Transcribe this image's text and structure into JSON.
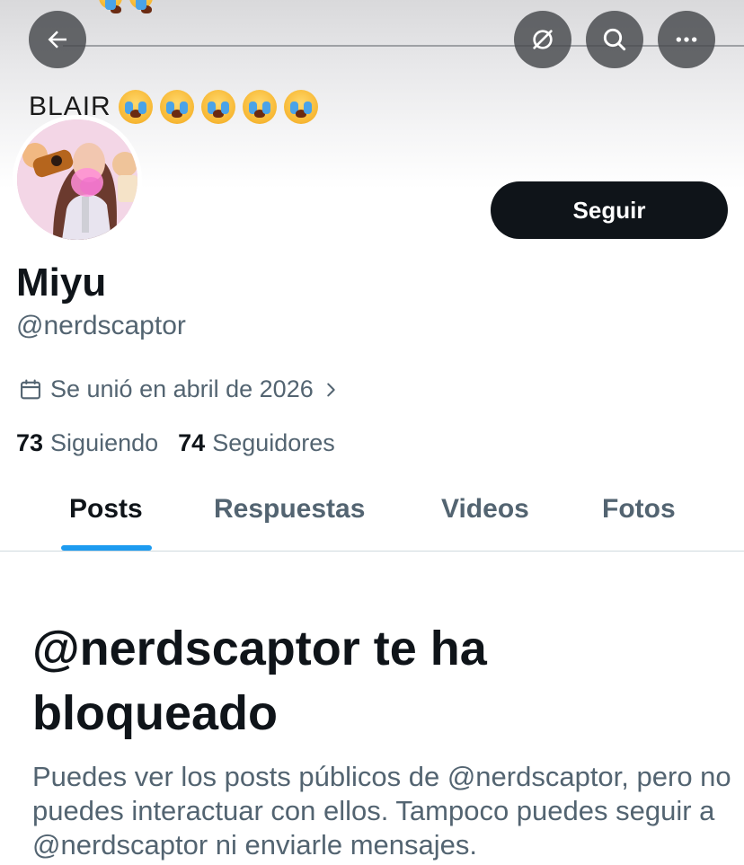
{
  "header": {
    "back_icon": "arrow-left-icon",
    "translate_icon": "translate-off-icon",
    "search_icon": "search-icon",
    "more_icon": "more-horizontal-icon",
    "banner_caption": "BLAIR",
    "banner_emoji": "loudly-crying-face"
  },
  "profile": {
    "display_name": "Miyu",
    "handle": "@nerdscaptor",
    "follow_label": "Seguir",
    "joined_icon": "calendar-icon",
    "joined_text": "Se unió en abril de 2026",
    "following_count": "73",
    "following_label": "Siguiendo",
    "followers_count": "74",
    "followers_label": "Seguidores"
  },
  "tabs": [
    {
      "label": "Posts",
      "active": true
    },
    {
      "label": "Respuestas",
      "active": false
    },
    {
      "label": "Videos",
      "active": false
    },
    {
      "label": "Fotos",
      "active": false
    }
  ],
  "blocked": {
    "title": "@nerdscaptor te ha bloqueado",
    "description": "Puedes ver los posts públicos de @nerdscaptor, pero no puedes interactuar con ellos. Tampoco puedes seguir a @nerdscaptor ni enviarle mensajes."
  },
  "colors": {
    "text_primary": "#0f1419",
    "text_secondary": "#536471",
    "accent": "#1d9bf0",
    "button_dark": "#0f1419",
    "divider": "#cfd9de"
  }
}
